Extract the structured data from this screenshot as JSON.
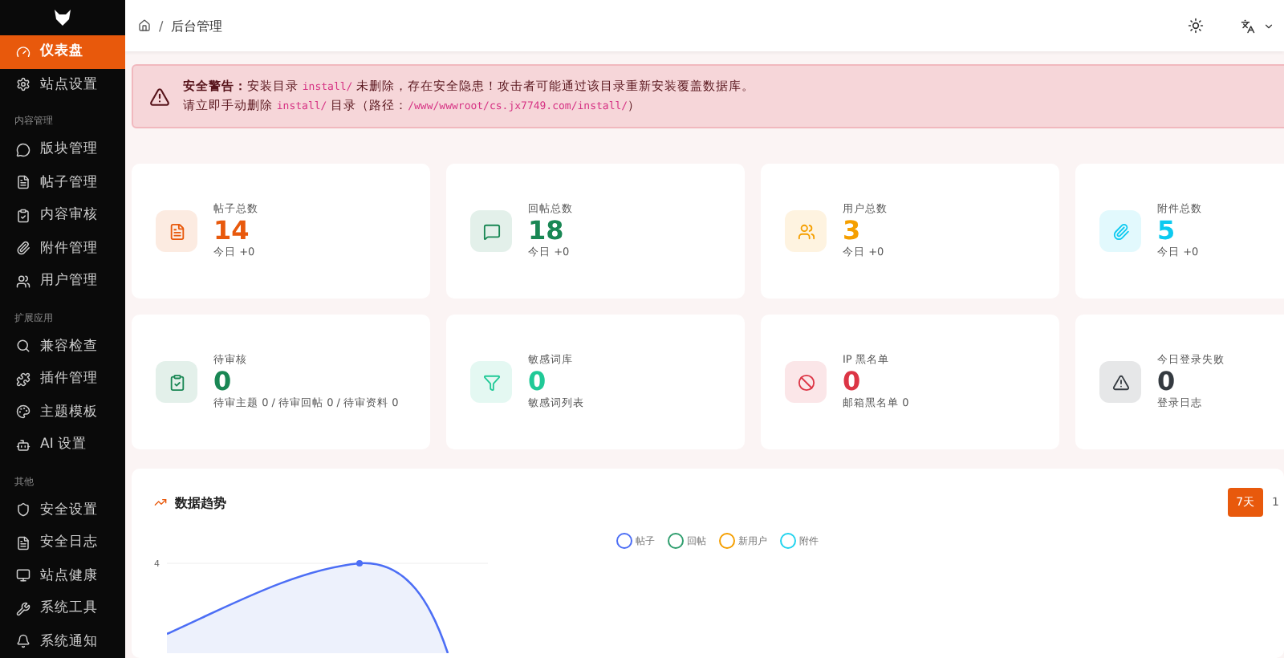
{
  "sidebar": {
    "sections": [
      {
        "items": [
          {
            "label": "仪表盘",
            "selected": true
          },
          {
            "label": "站点设置",
            "selected": false
          }
        ]
      },
      {
        "label": "内容管理",
        "items": [
          {
            "label": "版块管理",
            "selected": false
          },
          {
            "label": "帖子管理",
            "selected": false
          },
          {
            "label": "内容审核",
            "selected": false
          },
          {
            "label": "附件管理",
            "selected": false
          },
          {
            "label": "用户管理",
            "selected": false
          }
        ]
      },
      {
        "label": "扩展应用",
        "items": [
          {
            "label": "兼容检查",
            "selected": false
          },
          {
            "label": "插件管理",
            "selected": false
          },
          {
            "label": "主题模板",
            "selected": false
          },
          {
            "label": "AI 设置",
            "selected": false
          }
        ]
      },
      {
        "label": "其他",
        "items": [
          {
            "label": "安全设置",
            "selected": false
          },
          {
            "label": "安全日志",
            "selected": false
          },
          {
            "label": "站点健康",
            "selected": false
          },
          {
            "label": "系统工具",
            "selected": false
          },
          {
            "label": "系统通知",
            "selected": false
          }
        ]
      }
    ]
  },
  "breadcrumb": {
    "separator": "/",
    "current": "后台管理"
  },
  "alert": {
    "line1_parts": [
      {
        "kind": "bold",
        "text": "安全警告："
      },
      {
        "kind": "text",
        "text": "安装目录 "
      },
      {
        "kind": "code",
        "text": "install/"
      },
      {
        "kind": "text",
        "text": " 未删除，存在安全隐患！攻击者可能通过该目录重新安装覆盖数据库。"
      }
    ],
    "line2_parts": [
      {
        "kind": "text",
        "text": "请立即手动删除 "
      },
      {
        "kind": "code",
        "text": "install/"
      },
      {
        "kind": "text",
        "text": " 目录（路径："
      },
      {
        "kind": "code",
        "text": "/www/wwwroot/cs.jx7749.com/install/"
      },
      {
        "kind": "text",
        "text": "）"
      }
    ]
  },
  "stats": [
    {
      "title": "帖子总数",
      "value": "14",
      "sub": "今日 +0",
      "color": "#e8590c"
    },
    {
      "title": "回帖总数",
      "value": "18",
      "sub": "今日 +0",
      "color": "#198754"
    },
    {
      "title": "用户总数",
      "value": "3",
      "sub": "今日 +0",
      "color": "#f59f00"
    },
    {
      "title": "附件总数",
      "value": "5",
      "sub": "今日 +0",
      "color": "#0dcaf0"
    },
    {
      "title": "待审核",
      "value": "0",
      "sub": "待审主题 0 / 待审回帖 0 / 待审资料 0",
      "color": "#198754"
    },
    {
      "title": "敏感词库",
      "value": "0",
      "sub": "敏感词列表",
      "color": "#20c997"
    },
    {
      "title": "IP 黑名单",
      "value": "0",
      "sub": "邮箱黑名单 0",
      "color": "#dc3545"
    },
    {
      "title": "今日登录失败",
      "value": "0",
      "sub": "登录日志",
      "color": "#343a40"
    }
  ],
  "trend": {
    "title": "数据趋势",
    "ranges": [
      {
        "label": "7天",
        "selected": true
      },
      {
        "label": "1",
        "selected": false
      }
    ],
    "legend": [
      {
        "label": "帖子",
        "color": "#4c6ef5"
      },
      {
        "label": "回帖",
        "color": "#2f9e6e"
      },
      {
        "label": "新用户",
        "color": "#f59f00"
      },
      {
        "label": "附件",
        "color": "#22d3ee"
      }
    ],
    "y_label": "4"
  }
}
